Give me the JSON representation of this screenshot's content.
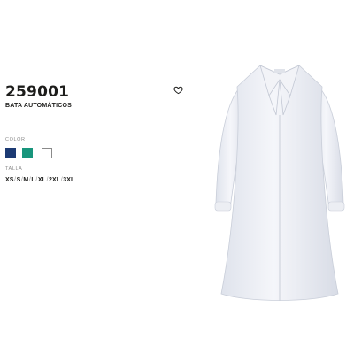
{
  "product": {
    "code": "259001",
    "name": "BATA AUTOMÁTICOS"
  },
  "wishlist": {
    "icon": "heart-outline-icon"
  },
  "color_section": {
    "label": "COLOR",
    "swatches": [
      {
        "name": "navy",
        "hex": "#1c3a73"
      },
      {
        "name": "green",
        "hex": "#18957c"
      },
      {
        "name": "white",
        "hex": "#ffffff"
      }
    ]
  },
  "size_section": {
    "label": "TALLA",
    "sizes": [
      "XS",
      "S",
      "M",
      "L",
      "XL",
      "2XL",
      "3XL"
    ]
  },
  "image": {
    "subject": "white-lab-coat"
  }
}
